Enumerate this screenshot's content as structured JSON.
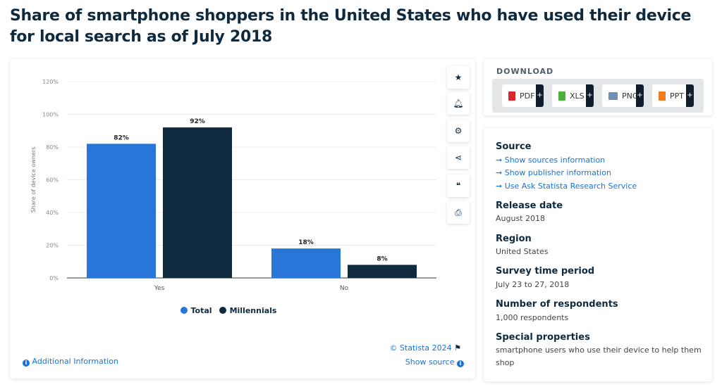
{
  "title": "Share of smartphone shoppers in the United States who have used their device for local search as of July 2018",
  "chart_data": {
    "type": "bar",
    "categories": [
      "Yes",
      "No"
    ],
    "series": [
      {
        "name": "Total",
        "values": [
          82,
          18
        ],
        "color": "#2876d8"
      },
      {
        "name": "Millennials",
        "values": [
          92,
          8
        ],
        "color": "#0f2a3f"
      }
    ],
    "data_labels": [
      [
        "82%",
        "18%"
      ],
      [
        "92%",
        "8%"
      ]
    ],
    "ylabel": "Share of device owners",
    "ylim": [
      0,
      120
    ],
    "yticks": [
      "0%",
      "20%",
      "40%",
      "60%",
      "80%",
      "100%",
      "120%"
    ],
    "grid": true,
    "legend": "bottom"
  },
  "toolbar": {
    "icons": [
      "star-icon",
      "bell-icon",
      "gear-icon",
      "share-icon",
      "quote-icon",
      "print-icon"
    ]
  },
  "footer": {
    "copyright": "© Statista 2024",
    "additional_info": "Additional Information",
    "show_source": "Show source"
  },
  "download": {
    "heading": "DOWNLOAD",
    "buttons": [
      {
        "label": "PDF",
        "color": "#d9262b"
      },
      {
        "label": "XLS",
        "color": "#4caf3c"
      },
      {
        "label": "PNG",
        "color": "#6f8fb5"
      },
      {
        "label": "PPT",
        "color": "#ef7d22"
      }
    ]
  },
  "meta": {
    "source_heading": "Source",
    "source_links": [
      "Show sources information",
      "Show publisher information",
      "Use Ask Statista Research Service"
    ],
    "release_heading": "Release date",
    "release": "August 2018",
    "region_heading": "Region",
    "region": "United States",
    "period_heading": "Survey time period",
    "period": "July 23 to 27, 2018",
    "respondents_heading": "Number of respondents",
    "respondents": "1,000 respondents",
    "special_heading": "Special properties",
    "special": "smartphone users who use their device to help them shop"
  }
}
